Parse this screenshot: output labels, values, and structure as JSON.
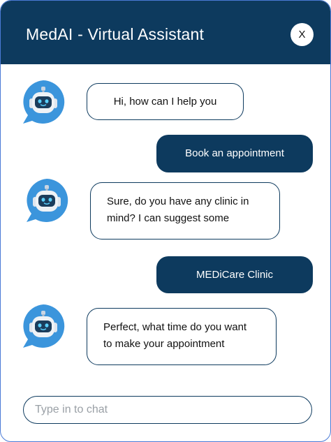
{
  "header": {
    "title": "MedAI - Virtual Assistant",
    "close_label": "X"
  },
  "messages": [
    {
      "sender": "bot",
      "text": "Hi, how can I help you"
    },
    {
      "sender": "user",
      "text": "Book an appointment"
    },
    {
      "sender": "bot",
      "lines": [
        "Sure, do you have any clinic in",
        "mind? I can suggest some"
      ]
    },
    {
      "sender": "user",
      "text": "MEDiCare Clinic"
    },
    {
      "sender": "bot",
      "lines": [
        "Perfect, what time do you want",
        "to make your appointment"
      ]
    }
  ],
  "input": {
    "placeholder": "Type in to chat",
    "value": ""
  },
  "colors": {
    "primary": "#0d3a5e",
    "bot_avatar": "#3b95dc",
    "border": "#4a7ad6"
  }
}
